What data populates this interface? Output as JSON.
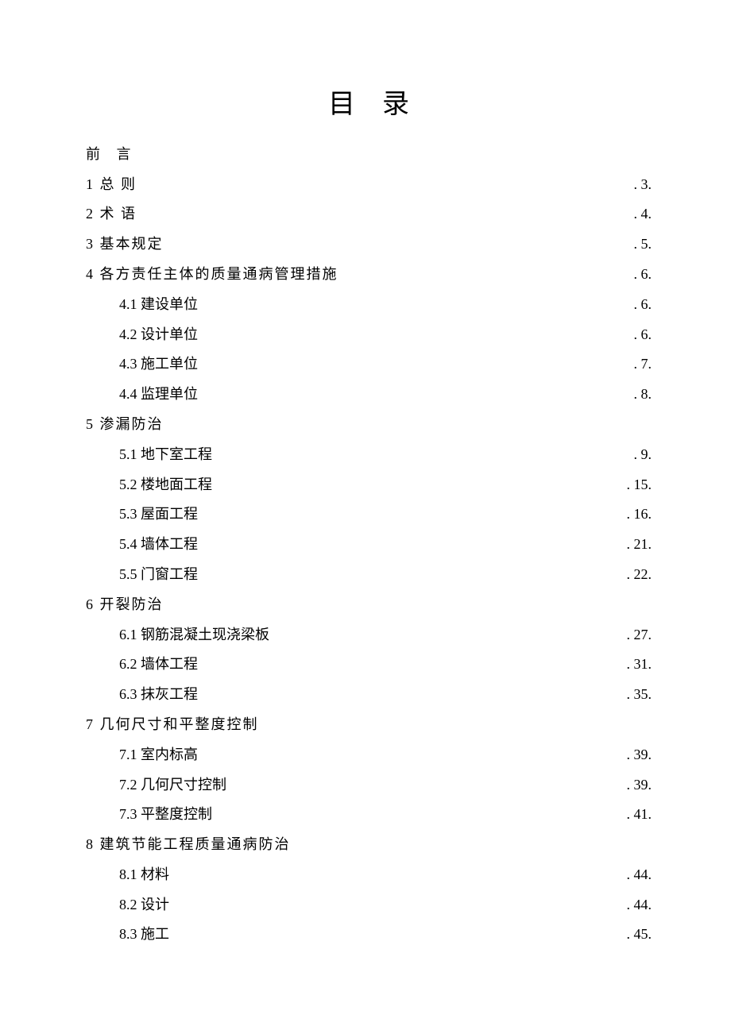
{
  "title": "目录",
  "entries": [
    {
      "level": 1,
      "label": "前 言",
      "page": "",
      "cls": "preface"
    },
    {
      "level": 1,
      "label": "1 总 则",
      "page": ". 3."
    },
    {
      "level": 1,
      "label": "2 术 语",
      "page": ". 4."
    },
    {
      "level": 1,
      "label": "3 基本规定",
      "page": ". 5."
    },
    {
      "level": 1,
      "label": "4 各方责任主体的质量通病管理措施",
      "page": ". 6."
    },
    {
      "level": 2,
      "label": "4.1 建设单位",
      "page": ". 6."
    },
    {
      "level": 2,
      "label": "4.2 设计单位",
      "page": ". 6."
    },
    {
      "level": 2,
      "label": "4.3 施工单位",
      "page": ". 7."
    },
    {
      "level": 2,
      "label": "4.4 监理单位",
      "page": ". 8."
    },
    {
      "level": 1,
      "label": "5 渗漏防治",
      "page": ""
    },
    {
      "level": 2,
      "label": "5.1 地下室工程",
      "page": ". 9."
    },
    {
      "level": 2,
      "label": "5.2 楼地面工程",
      "page": ". 15."
    },
    {
      "level": 2,
      "label": "5.3 屋面工程",
      "page": ". 16."
    },
    {
      "level": 2,
      "label": "5.4 墙体工程",
      "page": ". 21."
    },
    {
      "level": 2,
      "label": "5.5 门窗工程",
      "page": ". 22."
    },
    {
      "level": 1,
      "label": "6 开裂防治",
      "page": ""
    },
    {
      "level": 2,
      "label": "6.1 钢筋混凝土现浇梁板",
      "page": ". 27."
    },
    {
      "level": 2,
      "label": "6.2 墙体工程",
      "page": ". 31."
    },
    {
      "level": 2,
      "label": "6.3 抹灰工程",
      "page": ". 35."
    },
    {
      "level": 1,
      "label": "7 几何尺寸和平整度控制",
      "page": ""
    },
    {
      "level": 2,
      "label": "7.1 室内标高",
      "page": ". 39."
    },
    {
      "level": 2,
      "label": "7.2 几何尺寸控制",
      "page": ". 39."
    },
    {
      "level": 2,
      "label": "7.3 平整度控制",
      "page": ". 41."
    },
    {
      "level": 1,
      "label": "8 建筑节能工程质量通病防治",
      "page": ""
    },
    {
      "level": 2,
      "label": "8.1 材料",
      "page": ". 44."
    },
    {
      "level": 2,
      "label": "8.2 设计",
      "page": ". 44."
    },
    {
      "level": 2,
      "label": "8.3 施工",
      "page": ". 45."
    }
  ]
}
